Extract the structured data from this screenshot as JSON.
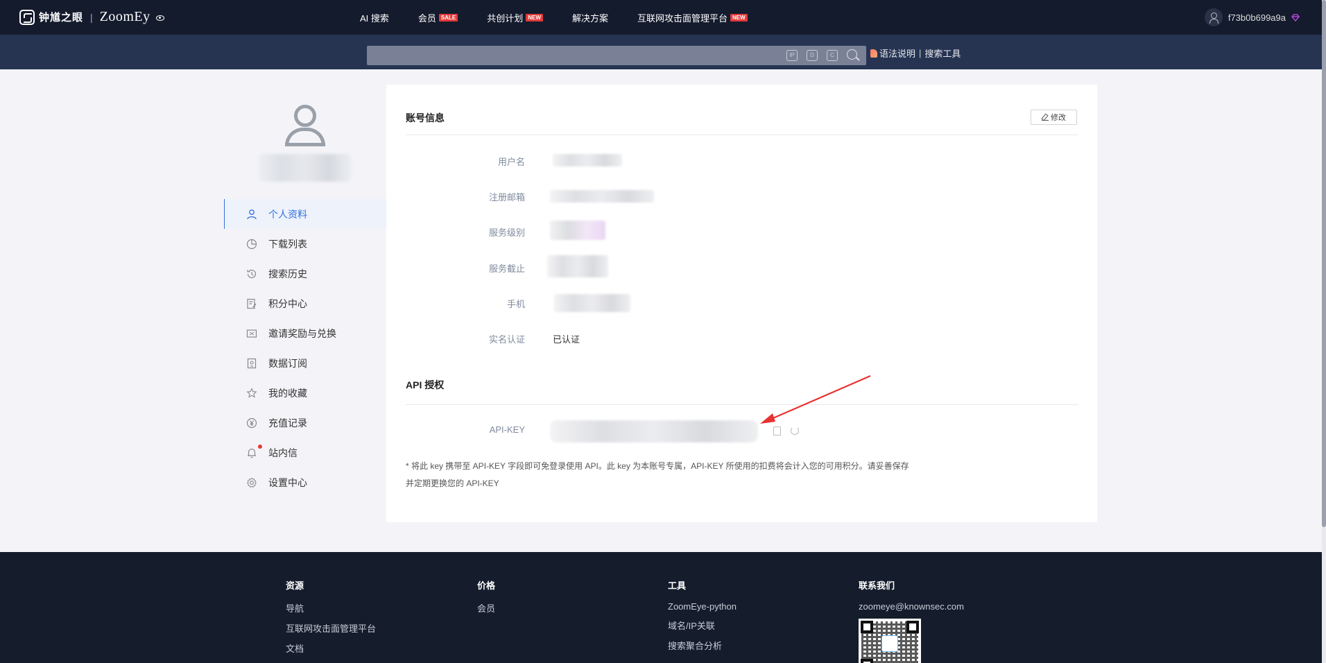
{
  "brand": {
    "name_cn": "钟馗之眼",
    "name_en": "ZoomEy"
  },
  "nav": {
    "links": [
      {
        "label": "AI 搜索",
        "tag": ""
      },
      {
        "label": "会员",
        "tag": "SALE"
      },
      {
        "label": "共创计划",
        "tag": "NEW"
      },
      {
        "label": "解决方案",
        "tag": ""
      },
      {
        "label": "互联网攻击面管理平台",
        "tag": "NEW"
      }
    ],
    "username": "f73b0b699a9a"
  },
  "search": {
    "placeholder": "",
    "tool_icons": [
      "IP",
      "D",
      "C"
    ],
    "help_link": "语法说明",
    "tools_link": "搜索工具"
  },
  "sidebar": {
    "items": [
      {
        "label": "个人资料",
        "icon": "user-icon",
        "active": true
      },
      {
        "label": "下载列表",
        "icon": "pie-chart-icon"
      },
      {
        "label": "搜索历史",
        "icon": "history-icon"
      },
      {
        "label": "积分中心",
        "icon": "points-icon"
      },
      {
        "label": "邀请奖励与兑换",
        "icon": "ticket-icon"
      },
      {
        "label": "数据订阅",
        "icon": "subscription-icon"
      },
      {
        "label": "我的收藏",
        "icon": "star-icon"
      },
      {
        "label": "充值记录",
        "icon": "yuan-icon"
      },
      {
        "label": "站内信",
        "icon": "bell-icon",
        "has_notification": true
      },
      {
        "label": "设置中心",
        "icon": "gear-icon"
      }
    ]
  },
  "account": {
    "title": "账号信息",
    "edit_label": "修改",
    "fields": [
      {
        "label": "用户名",
        "value": ""
      },
      {
        "label": "注册邮箱",
        "value": ""
      },
      {
        "label": "服务级别",
        "value": ""
      },
      {
        "label": "服务截止",
        "value": ""
      },
      {
        "label": "手机",
        "value": ""
      },
      {
        "label": "实名认证",
        "value": "已认证"
      }
    ]
  },
  "api": {
    "title": "API 授权",
    "key_label": "API-KEY",
    "note": "* 将此 key 携带至 API-KEY 字段即可免登录使用 API。此 key 为本账号专属，API-KEY 所使用的扣费将会计入您的可用积分。请妥善保存并定期更换您的 API-KEY"
  },
  "footer": {
    "columns": [
      {
        "heading": "资源",
        "links": [
          "导航",
          "互联网攻击面管理平台",
          "文档"
        ]
      },
      {
        "heading": "价格",
        "links": [
          "会员"
        ]
      },
      {
        "heading": "工具",
        "links": [
          "ZoomEye-python",
          "域名/IP关联",
          "搜索聚合分析"
        ]
      },
      {
        "heading": "联系我们",
        "links": [
          "zoomeye@knownsec.com"
        ]
      }
    ]
  },
  "colors": {
    "nav_bg": "#141b2d",
    "search_bg": "#263452",
    "accent": "#2f6fe0",
    "annotation_arrow": "#e8322f"
  }
}
